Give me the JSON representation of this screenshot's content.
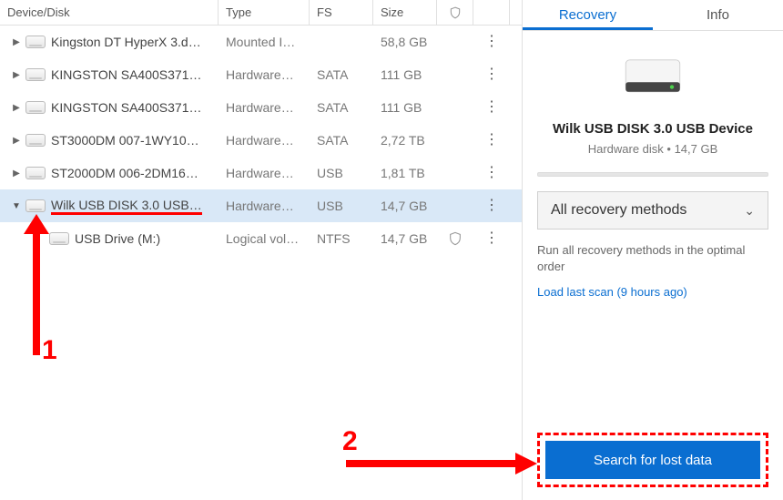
{
  "columns": {
    "device": "Device/Disk",
    "type": "Type",
    "fs": "FS",
    "size": "Size"
  },
  "rows": [
    {
      "name": "Kingston DT HyperX 3.d…",
      "type": "Mounted I…",
      "fs": "",
      "size": "58,8 GB"
    },
    {
      "name": "KINGSTON  SA400S371…",
      "type": "Hardware…",
      "fs": "SATA",
      "size": "111 GB"
    },
    {
      "name": "KINGSTON  SA400S371…",
      "type": "Hardware…",
      "fs": "SATA",
      "size": "111 GB"
    },
    {
      "name": "ST3000DM 007-1WY10…",
      "type": "Hardware…",
      "fs": "SATA",
      "size": "2,72 TB"
    },
    {
      "name": "ST2000DM 006-2DM16…",
      "type": "Hardware…",
      "fs": "USB",
      "size": "1,81 TB"
    },
    {
      "name": "Wilk USB DISK 3.0 USB…",
      "type": "Hardware…",
      "fs": "USB",
      "size": "14,7 GB"
    },
    {
      "name": "USB Drive (M:)",
      "type": "Logical vol…",
      "fs": "NTFS",
      "size": "14,7 GB"
    }
  ],
  "tabs": {
    "recovery": "Recovery",
    "info": "Info"
  },
  "detail": {
    "title": "Wilk USB DISK 3.0 USB Device",
    "subtitle": "Hardware disk • 14,7 GB",
    "dropdown": "All recovery methods",
    "hint": "Run all recovery methods in the optimal order",
    "link": "Load last scan (9 hours ago)",
    "button": "Search for lost data"
  },
  "annotations": {
    "label1": "1",
    "label2": "2"
  }
}
